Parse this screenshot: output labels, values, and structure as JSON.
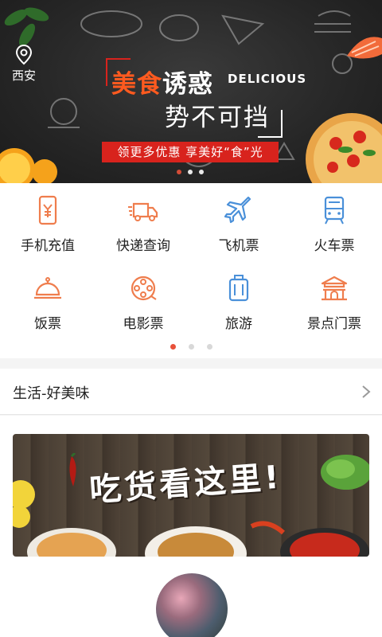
{
  "banner": {
    "location": "西安",
    "headline_orange": "美食",
    "headline_white": "诱惑",
    "headline_en": "DELICIOUS",
    "headline_line2": "势不可挡",
    "promo_text": "领更多优惠  享美好“食”光",
    "carousel": {
      "count": 3,
      "active_index": 0
    }
  },
  "services": [
    {
      "label": "手机充值",
      "icon": "phone-recharge-icon"
    },
    {
      "label": "快递查询",
      "icon": "delivery-truck-icon"
    },
    {
      "label": "飞机票",
      "icon": "airplane-icon"
    },
    {
      "label": "火车票",
      "icon": "train-icon"
    },
    {
      "label": "饭票",
      "icon": "food-dome-icon"
    },
    {
      "label": "电影票",
      "icon": "film-reel-icon"
    },
    {
      "label": "旅游",
      "icon": "suitcase-icon"
    },
    {
      "label": "景点门票",
      "icon": "landmark-gate-icon"
    }
  ],
  "services_pager": {
    "count": 3,
    "active_index": 0
  },
  "section": {
    "title": "生活-好美味",
    "promo_title": "吃货看这里!"
  },
  "colors": {
    "accent": "#e8513a",
    "icon_orange": "#ef7d4d",
    "icon_blue": "#4a90d9",
    "promo_red": "#d8231d"
  }
}
